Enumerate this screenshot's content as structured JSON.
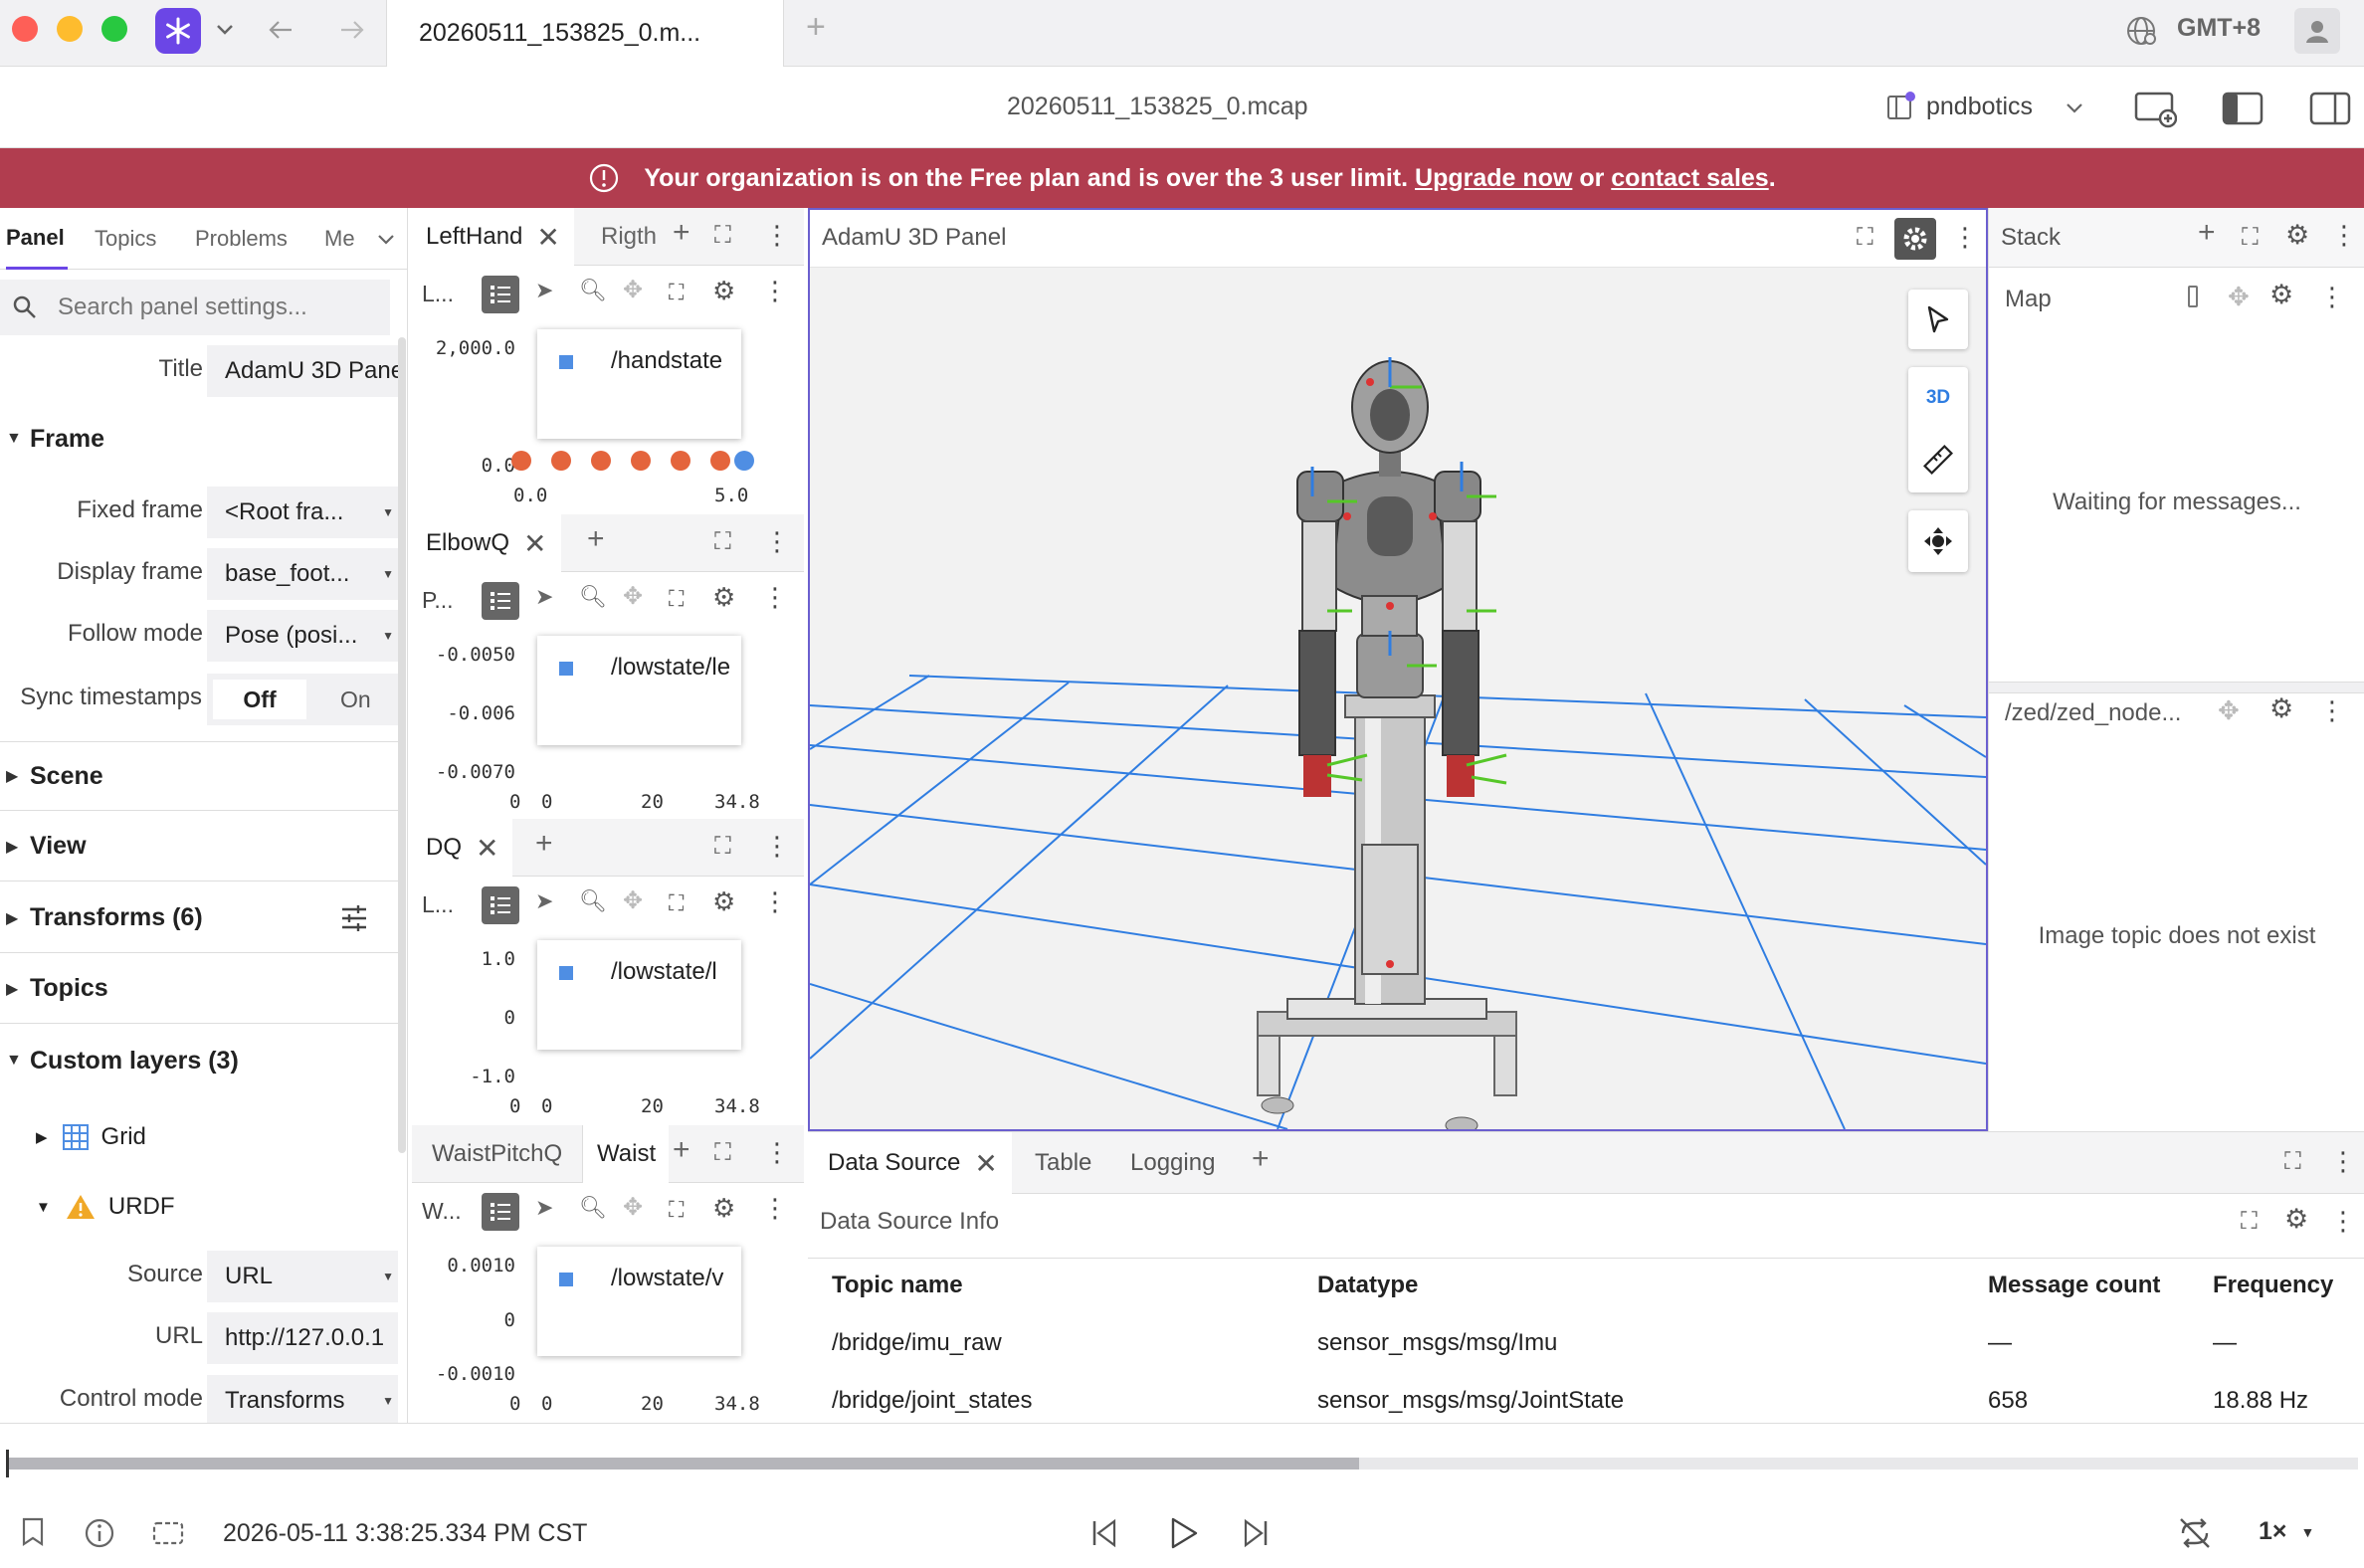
{
  "tabs": {
    "active_label": "20260511_153825_0.m...",
    "timezone": "GMT+8"
  },
  "appbar": {
    "file_title": "20260511_153825_0.mcap",
    "org": "pndbotics"
  },
  "banner": {
    "text_before": "Your organization is on the Free plan and is over the 3 user limit.",
    "upgrade": "Upgrade now",
    "or": "or",
    "contact": "contact sales",
    "end": "."
  },
  "settings": {
    "tabs": [
      "Panel",
      "Topics",
      "Problems",
      "Me"
    ],
    "search_placeholder": "Search panel settings...",
    "title_label": "Title",
    "title_value": "AdamU 3D Panel",
    "frame": "Frame",
    "fixed_frame_label": "Fixed frame",
    "fixed_frame_value": "<Root fra...",
    "display_frame_label": "Display frame",
    "display_frame_value": "base_foot...",
    "follow_mode_label": "Follow mode",
    "follow_mode_value": "Pose (posi...",
    "sync_label": "Sync timestamps",
    "sync_off": "Off",
    "sync_on": "On",
    "scene": "Scene",
    "view": "View",
    "transforms": "Transforms (6)",
    "topics": "Topics",
    "custom_layers": "Custom layers (3)",
    "grid": "Grid",
    "urdf": "URDF",
    "source_label": "Source",
    "source_value": "URL",
    "url_label": "URL",
    "url_value": "http://127.0.0.1",
    "control_label": "Control mode",
    "control_value": "Transforms"
  },
  "plots": [
    {
      "tab1": "LeftHand",
      "tab2": "Rigth",
      "tool_label": "L...",
      "legend": "/handstate",
      "yticks": [
        "2,000.0",
        "0.0"
      ],
      "xticks": [
        "0.0",
        "5.0"
      ]
    },
    {
      "tab1": "ElbowQ",
      "tool_label": "P...",
      "legend": "/lowstate/le",
      "yticks": [
        "-0.0050",
        "-0.006",
        "-0.0070"
      ],
      "xticks": [
        "0",
        "0",
        "20",
        "34.8"
      ]
    },
    {
      "tab1": "DQ",
      "tool_label": "L...",
      "legend": "/lowstate/l",
      "yticks": [
        "1.0",
        "0",
        "-1.0"
      ],
      "xticks": [
        "0",
        "0",
        "20",
        "34.8"
      ]
    },
    {
      "tab1": "WaistPitchQ",
      "tab2": "Waist",
      "tool_label": "W...",
      "legend": "/lowstate/v",
      "yticks": [
        "0.0010",
        "0",
        "-0.0010"
      ],
      "xticks": [
        "0",
        "0",
        "20",
        "34.8"
      ]
    }
  ],
  "view3d": {
    "title": "AdamU 3D Panel",
    "mode_3d": "3D"
  },
  "right": {
    "stack": "Stack",
    "map": "Map",
    "map_msg": "Waiting for messages...",
    "image_topic": "/zed/zed_node...",
    "image_msg": "Image topic does not exist"
  },
  "datasource": {
    "tabs": [
      "Data Source",
      "Table",
      "Logging"
    ],
    "info": "Data Source Info",
    "headers": [
      "Topic name",
      "Datatype",
      "Message count",
      "Frequency"
    ],
    "rows": [
      [
        "/bridge/imu_raw",
        "sensor_msgs/msg/Imu",
        "—",
        "—"
      ],
      [
        "/bridge/joint_states",
        "sensor_msgs/msg/JointState",
        "658",
        "18.88 Hz"
      ]
    ]
  },
  "playback": {
    "time": "2026-05-11 3:38:25.334 PM CST",
    "speed": "1×",
    "progress": 0.575
  },
  "colors": {
    "accent": "#6b5fcf",
    "banner": "#b13d4f",
    "legend_blue": "#4f8ee3",
    "legend_orange": "#e4643c",
    "grid_blue": "#2f7de1"
  },
  "icons": [
    "app-logo-icon",
    "globe-icon",
    "user-icon",
    "layout-icon",
    "sidebar-left-icon",
    "sidebar-right-icon",
    "search-icon",
    "gear-icon",
    "fullscreen-icon",
    "more-icon",
    "select-arrow-icon",
    "ruler-icon",
    "camera-icon",
    "play-icon",
    "skip-back-icon",
    "skip-forward-icon",
    "loop-icon",
    "bookmark-icon",
    "info-icon"
  ]
}
